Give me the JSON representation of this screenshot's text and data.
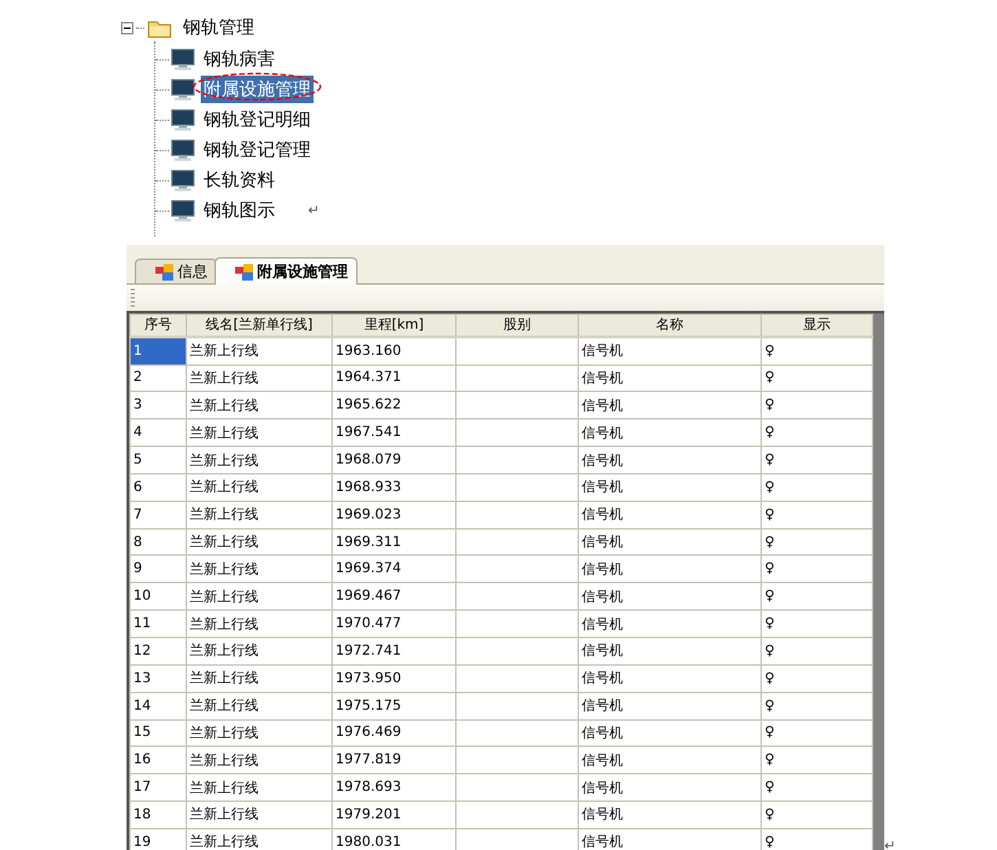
{
  "tree": {
    "label": "钢轨管理",
    "expanded": true,
    "children": [
      {
        "label": "钢轨病害",
        "selected": false,
        "circled": false
      },
      {
        "label": "附属设施管理",
        "selected": true,
        "circled": true
      },
      {
        "label": "钢轨登记明细",
        "selected": false,
        "circled": false
      },
      {
        "label": "钢轨登记管理",
        "selected": false,
        "circled": false
      },
      {
        "label": "长轨资料",
        "selected": false,
        "circled": false
      },
      {
        "label": "钢轨图示",
        "selected": false,
        "circled": false
      }
    ]
  },
  "tree_return_mark": "↵",
  "tabs": [
    {
      "label": "信息",
      "selected": false
    },
    {
      "label": "附属设施管理",
      "selected": true
    }
  ],
  "table": {
    "columns": [
      "序号",
      "线名[兰新单行线]",
      "里程[km]",
      "股别",
      "名称",
      "显示"
    ],
    "rows": [
      {
        "cells": [
          "1",
          "兰新上行线",
          "1963.160",
          "",
          "信号机",
          "♀"
        ],
        "selected": true
      },
      {
        "cells": [
          "2",
          "兰新上行线",
          "1964.371",
          "",
          "信号机",
          "♀"
        ],
        "selected": false
      },
      {
        "cells": [
          "3",
          "兰新上行线",
          "1965.622",
          "",
          "信号机",
          "♀"
        ],
        "selected": false
      },
      {
        "cells": [
          "4",
          "兰新上行线",
          "1967.541",
          "",
          "信号机",
          "♀"
        ],
        "selected": false
      },
      {
        "cells": [
          "5",
          "兰新上行线",
          "1968.079",
          "",
          "信号机",
          "♀"
        ],
        "selected": false
      },
      {
        "cells": [
          "6",
          "兰新上行线",
          "1968.933",
          "",
          "信号机",
          "♀"
        ],
        "selected": false
      },
      {
        "cells": [
          "7",
          "兰新上行线",
          "1969.023",
          "",
          "信号机",
          "♀"
        ],
        "selected": false
      },
      {
        "cells": [
          "8",
          "兰新上行线",
          "1969.311",
          "",
          "信号机",
          "♀"
        ],
        "selected": false
      },
      {
        "cells": [
          "9",
          "兰新上行线",
          "1969.374",
          "",
          "信号机",
          "♀"
        ],
        "selected": false
      },
      {
        "cells": [
          "10",
          "兰新上行线",
          "1969.467",
          "",
          "信号机",
          "♀"
        ],
        "selected": false
      },
      {
        "cells": [
          "11",
          "兰新上行线",
          "1970.477",
          "",
          "信号机",
          "♀"
        ],
        "selected": false
      },
      {
        "cells": [
          "12",
          "兰新上行线",
          "1972.741",
          "",
          "信号机",
          "♀"
        ],
        "selected": false
      },
      {
        "cells": [
          "13",
          "兰新上行线",
          "1973.950",
          "",
          "信号机",
          "♀"
        ],
        "selected": false
      },
      {
        "cells": [
          "14",
          "兰新上行线",
          "1975.175",
          "",
          "信号机",
          "♀"
        ],
        "selected": false
      },
      {
        "cells": [
          "15",
          "兰新上行线",
          "1976.469",
          "",
          "信号机",
          "♀"
        ],
        "selected": false
      },
      {
        "cells": [
          "16",
          "兰新上行线",
          "1977.819",
          "",
          "信号机",
          "♀"
        ],
        "selected": false
      },
      {
        "cells": [
          "17",
          "兰新上行线",
          "1978.693",
          "",
          "信号机",
          "♀"
        ],
        "selected": false
      },
      {
        "cells": [
          "18",
          "兰新上行线",
          "1979.201",
          "",
          "信号机",
          "♀"
        ],
        "selected": false
      },
      {
        "cells": [
          "19",
          "兰新上行线",
          "1980.031",
          "",
          "信号机",
          "♀"
        ],
        "selected": false
      }
    ]
  },
  "table_return_mark": "↵"
}
